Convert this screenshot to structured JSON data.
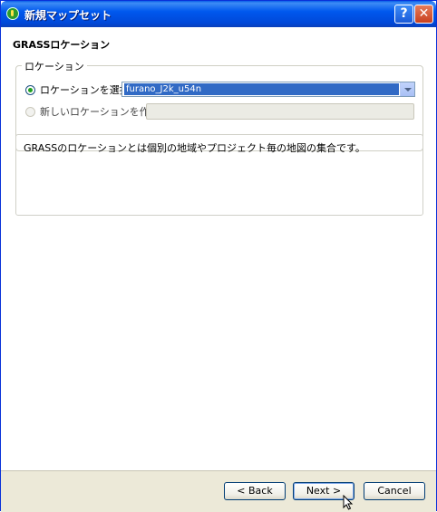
{
  "window": {
    "title": "新規マップセット",
    "help_glyph": "?",
    "close_glyph": "✕"
  },
  "page": {
    "heading": "GRASSロケーション"
  },
  "location_group": {
    "legend": "ロケーション",
    "select_existing_label": "ロケーションを選択",
    "select_existing_checked": true,
    "selected_location": "furano_J2k_u54n",
    "create_new_label": "新しいロケーションを作成",
    "create_new_checked": false,
    "new_location_value": ""
  },
  "description": {
    "text": "GRASSのロケーションとは個別の地域やプロジェクト毎の地図の集合です。"
  },
  "footer": {
    "back_label": "< Back",
    "next_label": "Next >",
    "cancel_label": "Cancel"
  }
}
